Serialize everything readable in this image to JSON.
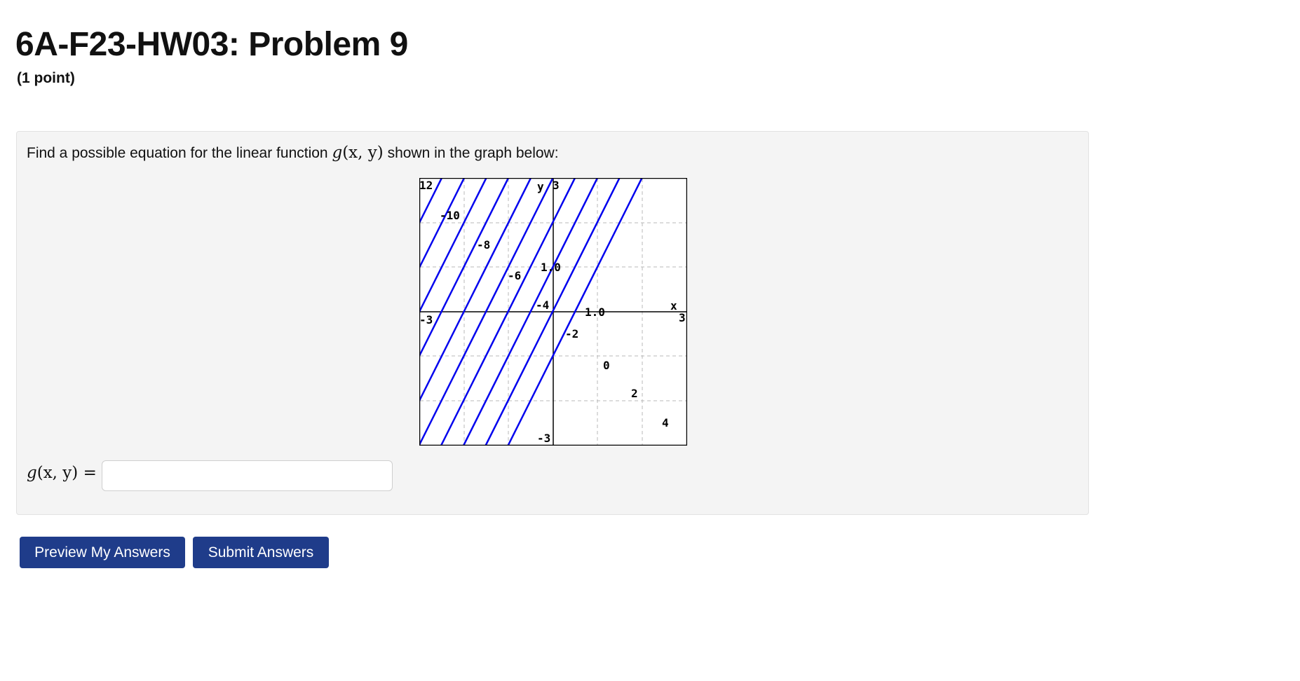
{
  "header": {
    "title": "6A-F23-HW03: Problem 9",
    "points": "(1 point)"
  },
  "problem": {
    "statement_before": "Find a possible equation for the linear function ",
    "function_name": "g",
    "function_args": "(x, y)",
    "statement_after": " shown in the graph below:"
  },
  "answer": {
    "label_name": "g",
    "label_args": "(x, y)",
    "label_equals": " =",
    "value": "",
    "placeholder": ""
  },
  "buttons": {
    "preview_label": "Preview My Answers",
    "submit_label": "Submit Answers"
  },
  "graph": {
    "line_color": "#0000ee",
    "axis_labels": {
      "x": "x",
      "y": "y"
    },
    "corner_labels": {
      "top_left": "12",
      "left": "-3",
      "top": "3",
      "right": "3",
      "bottom": "-3"
    },
    "contour_labels": [
      "-10",
      "-8",
      "-6",
      "-4",
      "-2",
      "0",
      "2",
      "4",
      "1.0",
      "1.0"
    ]
  }
}
